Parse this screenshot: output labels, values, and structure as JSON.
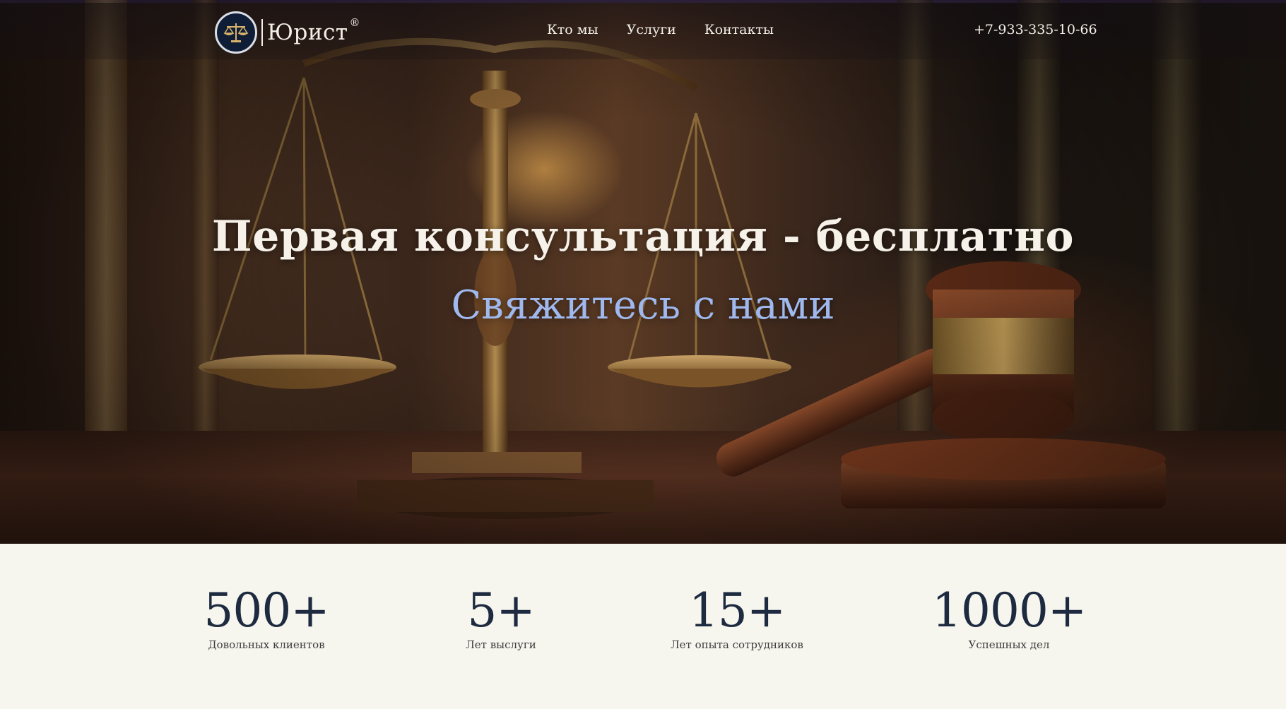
{
  "header": {
    "logo_text": "Юрист",
    "logo_mark": "®",
    "logo_icon": "scales-icon",
    "nav": [
      {
        "label": "Кто мы"
      },
      {
        "label": "Услуги"
      },
      {
        "label": "Контакты"
      }
    ],
    "phone": "+7-933-335-10-66"
  },
  "hero": {
    "headline": "Первая консультация - бесплатно",
    "cta": "Свяжитесь с нами",
    "cta_color": "#9fb8ee"
  },
  "stats": [
    {
      "value": "500+",
      "label": "Довольных клиентов"
    },
    {
      "value": "5+",
      "label": "Лет выслуги"
    },
    {
      "value": "15+",
      "label": "Лет опыта сотрудников"
    },
    {
      "value": "1000+",
      "label": "Успешных дел"
    }
  ],
  "colors": {
    "stat_number": "#1d2a3f",
    "page_background": "#f6f6ef",
    "logo_badge": "#0f1e36"
  }
}
